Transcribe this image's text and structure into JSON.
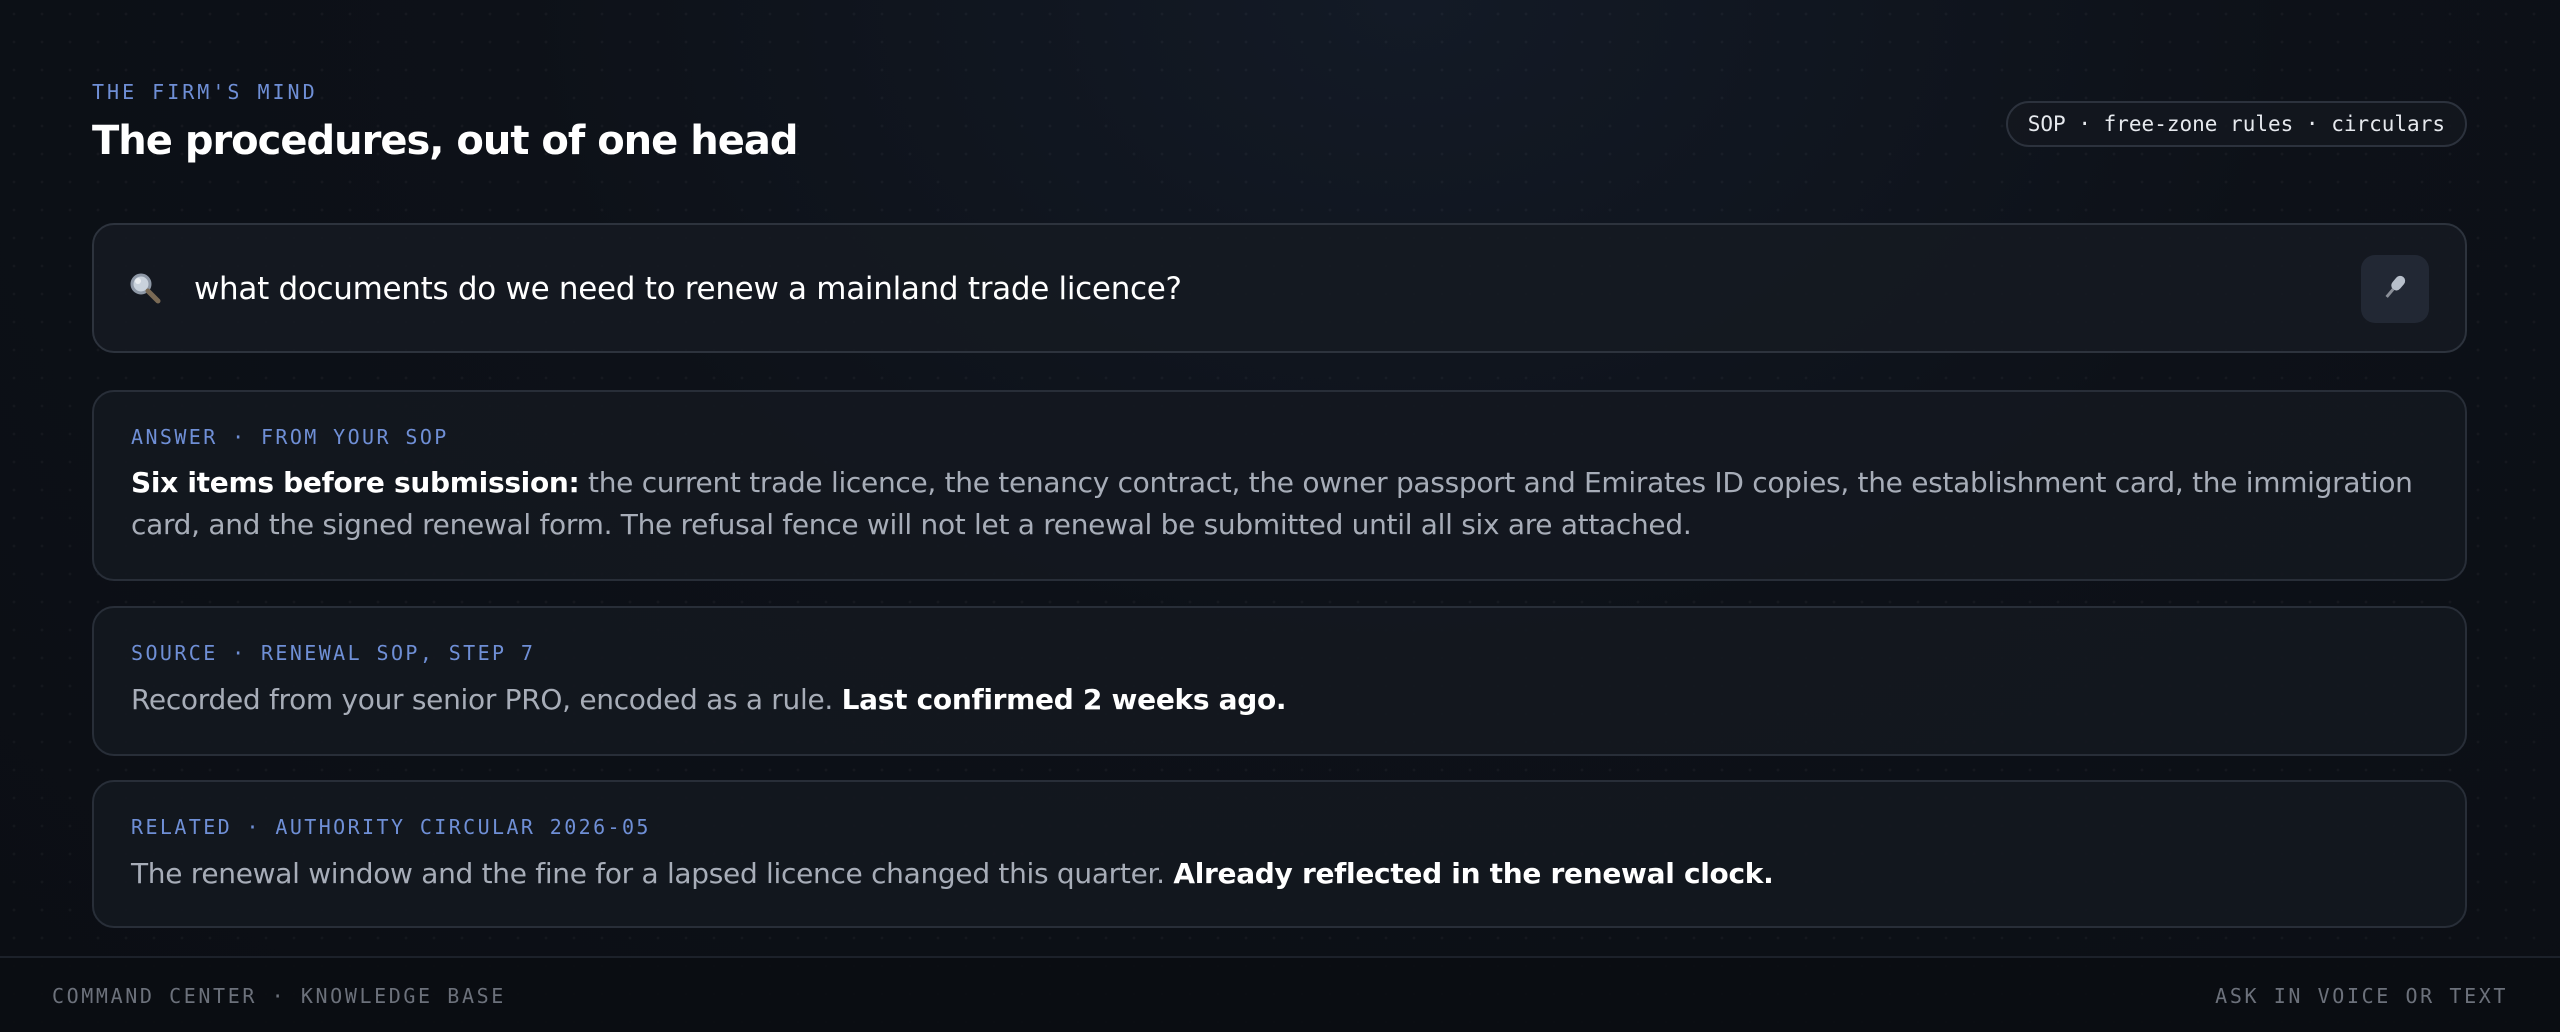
{
  "header": {
    "eyebrow": "THE FIRM'S MIND",
    "title": "The procedures, out of one head",
    "scope": "SOP · free-zone rules · circulars"
  },
  "search": {
    "query": "what documents do we need to renew a mainland trade licence?",
    "search_icon": "magnifier-icon",
    "mic_icon": "microphone-icon"
  },
  "cards": {
    "answer": {
      "label": "ANSWER · FROM YOUR SOP",
      "lead": "Six items before submission:",
      "text": " the current trade licence, the tenancy contract, the owner passport and Emirates ID copies, the establishment card, the immigration card, and the signed renewal form. The refusal fence will not let a renewal be submitted until all six are attached."
    },
    "source": {
      "label": "SOURCE · RENEWAL SOP, STEP 7",
      "text": "Recorded from your senior PRO, encoded as a rule. ",
      "emphasis": "Last confirmed 2 weeks ago."
    },
    "related": {
      "label": "RELATED · AUTHORITY CIRCULAR 2026-05",
      "text": "The renewal window and the fine for a lapsed licence changed this quarter. ",
      "emphasis": "Already reflected in the renewal clock."
    }
  },
  "footer": {
    "left": "COMMAND CENTER · KNOWLEDGE BASE",
    "right": "ASK IN VOICE OR TEXT"
  },
  "colors": {
    "background": "#0d1118",
    "accent": "#6f8fd6",
    "card": "#14181f",
    "border": "#2d333d",
    "text_muted": "#a7adb8"
  }
}
